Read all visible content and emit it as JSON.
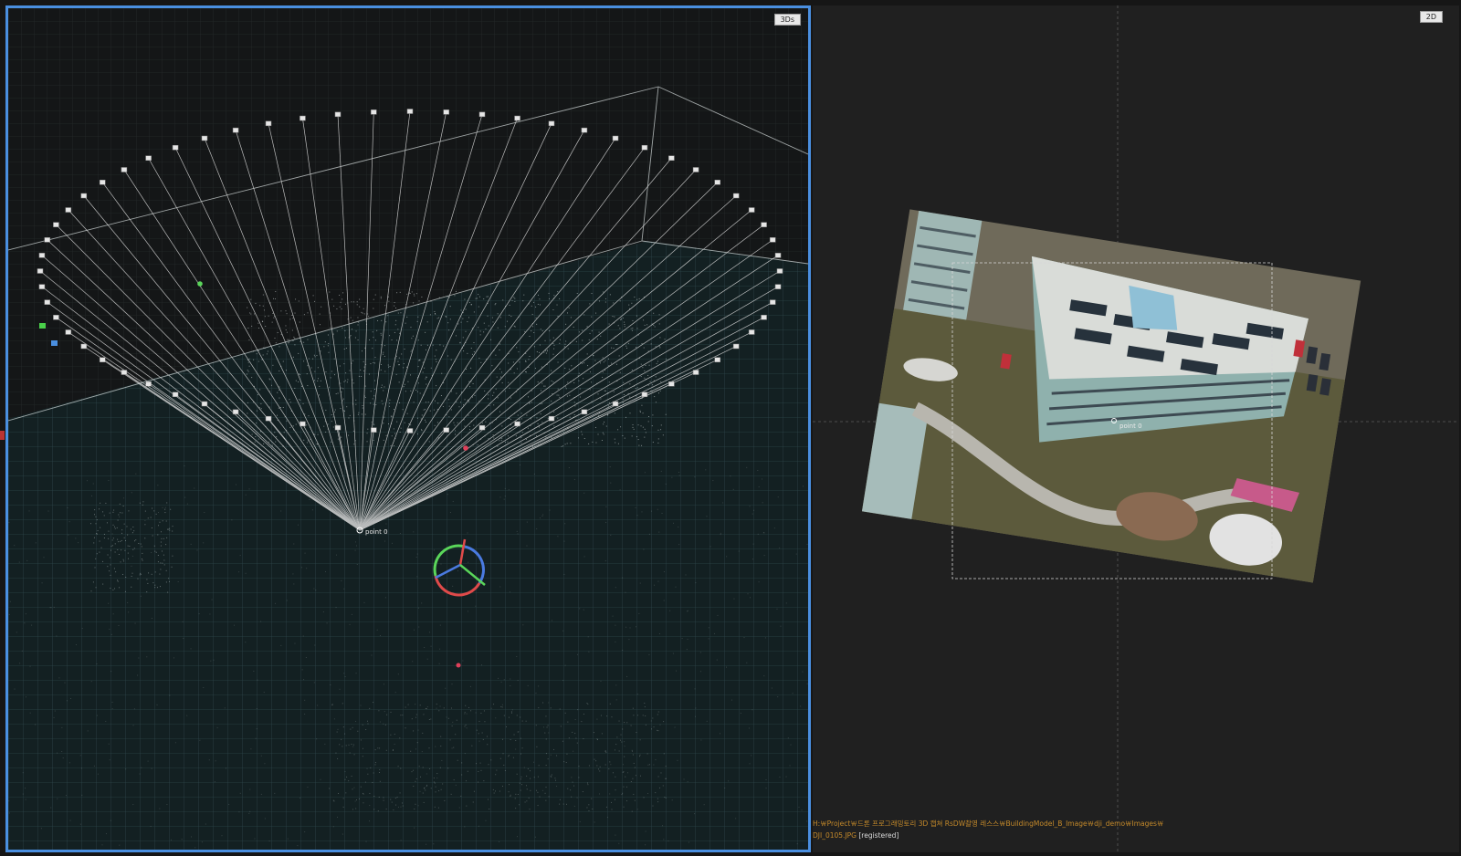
{
  "viewport_3d": {
    "mode_label": "3Ds",
    "point_label": "point 0",
    "camera_count": 64,
    "colors": {
      "active_border": "#4a8fe0",
      "background": "#101719",
      "grid": "#2f4a4f",
      "rays": "#d8d8d8",
      "axis_x": "#e04a4a",
      "axis_y": "#4ad04a",
      "axis_z": "#4a7ae0"
    }
  },
  "viewport_2d": {
    "mode_label": "2D",
    "point_label": "point 0",
    "image_path": "H:￦Project￦드론 프로그래밍토리 3D 캡쳐 RsDW촬영 레스스￦BuildingModel_B_Image￦dji_demo￦Images￦",
    "image_name": "DJI_0105.JPG",
    "image_status": "[registered]",
    "colors": {
      "background": "#202020",
      "path_text": "#c58a2a",
      "crosshair": "#5a5a5a"
    }
  }
}
